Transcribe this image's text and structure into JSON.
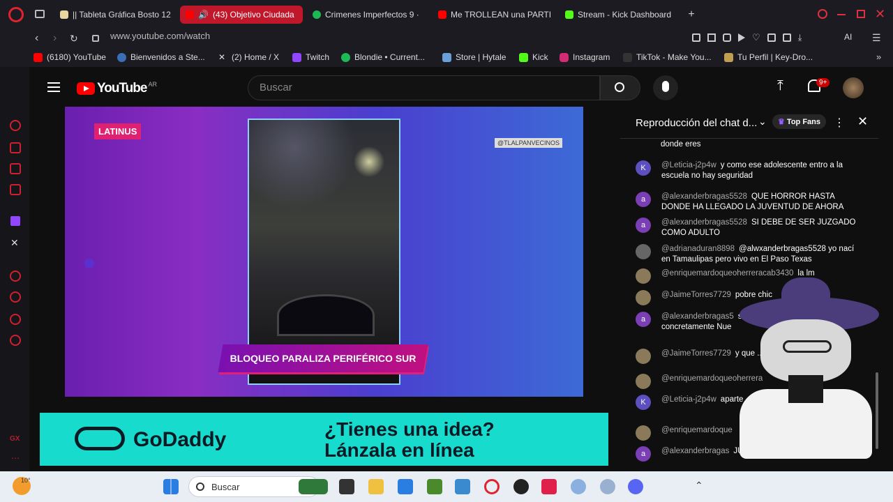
{
  "tabs": [
    {
      "label": "|| Tableta Gráfica Bosto 12",
      "color": "#e8d6a0",
      "active": false
    },
    {
      "label": "(43) Objetivo Ciudada",
      "color": "#ff0000",
      "active": true
    },
    {
      "label": "Crimenes Imperfectos 9 ·",
      "color": "#1db954",
      "active": false
    },
    {
      "label": "Me TROLLEAN una PARTI",
      "color": "#ff0000",
      "active": false
    },
    {
      "label": "Stream - Kick Dashboard",
      "color": "#53fc18",
      "active": false
    }
  ],
  "address": {
    "url": "www.youtube.com/watch",
    "ai_label": "AI"
  },
  "bookmarks": [
    {
      "label": "(6180) YouTube",
      "color": "#ff0000"
    },
    {
      "label": "Bienvenidos a Ste...",
      "color": "#3a6fb5"
    },
    {
      "label": "(2) Home / X",
      "color": "#444"
    },
    {
      "label": "Twitch",
      "color": "#9146ff"
    },
    {
      "label": "Blondie • Current...",
      "color": "#1db954"
    },
    {
      "label": "Store | Hytale",
      "color": "#6aa0d8"
    },
    {
      "label": "Kick",
      "color": "#53fc18"
    },
    {
      "label": "Instagram",
      "color": "#d62976"
    },
    {
      "label": "TikTok - Make You...",
      "color": "#222"
    },
    {
      "label": "Tu Perfil | Key-Dro...",
      "color": "#c0a050"
    }
  ],
  "youtube": {
    "logo": "YouTube",
    "region": "AR",
    "search_placeholder": "Buscar",
    "notif_count": "9+"
  },
  "video": {
    "brand": "LATINUS",
    "handle": "@TLALPANVECINOS",
    "caption": "BLOQUEO PARALIZA PERIFÉRICO SUR"
  },
  "ad": {
    "brand": "GoDaddy",
    "line1": "¿Tienes una idea?",
    "line2": "Lánzala en línea"
  },
  "chat": {
    "title": "Reproducción del chat d...",
    "filter": "Top Fans",
    "top_text": "donde eres",
    "messages": [
      {
        "initial": "K",
        "color": "#5c4fbf",
        "user": "@Leticia-j2p4w",
        "text": "y como ese adolescente entro a la escuela no hay seguridad"
      },
      {
        "initial": "a",
        "color": "#7b3fb5",
        "user": "@alexanderbragas5528",
        "text": "QUE HORROR HASTA DONDE HA LLEGADO LA JUVENTUD DE AHORA"
      },
      {
        "initial": "a",
        "color": "#7b3fb5",
        "user": "@alexanderbragas5528",
        "text": "SI DEBE DE SER JUZGADO COMO ADULTO"
      },
      {
        "initial": "",
        "color": "#666",
        "user": "@adrianaduran8898",
        "text": "@alwxanderbragas5528 yo nací en Tamaulipas pero vivo en El Paso Texas"
      },
      {
        "initial": "",
        "color": "#8a7a5a",
        "user": "@enriquemardoqueoherreracab3430",
        "text": "la lm"
      },
      {
        "initial": "",
        "color": "#8a7a5a",
        "user": "@JaimeTorres7729",
        "text": "pobre chic"
      },
      {
        "initial": "a",
        "color": "#7b3fb5",
        "user": "@alexanderbragas5",
        "text": "si estas algo lejos, yo concretamente Nue"
      },
      {
        "initial": "",
        "color": "#8a7a5a",
        "user": "@JaimeTorres7729",
        "text": "y que ... con M de inpudica"
      },
      {
        "initial": "",
        "color": "#8a7a5a",
        "user": "@enriquemardoqueoherrera",
        "text": ""
      },
      {
        "initial": "K",
        "color": "#5c4fbf",
        "user": "@Leticia-j2p4w",
        "text": "aparte ... no acaba"
      },
      {
        "initial": "",
        "color": "#8a7a5a",
        "user": "@enriquemardoque",
        "text": ""
      },
      {
        "initial": "a",
        "color": "#7b3fb5",
        "user": "@alexanderbragas",
        "text": "JUSTICIA CON P"
      }
    ]
  },
  "taskbar": {
    "temp": "10°",
    "search": "Buscar"
  }
}
